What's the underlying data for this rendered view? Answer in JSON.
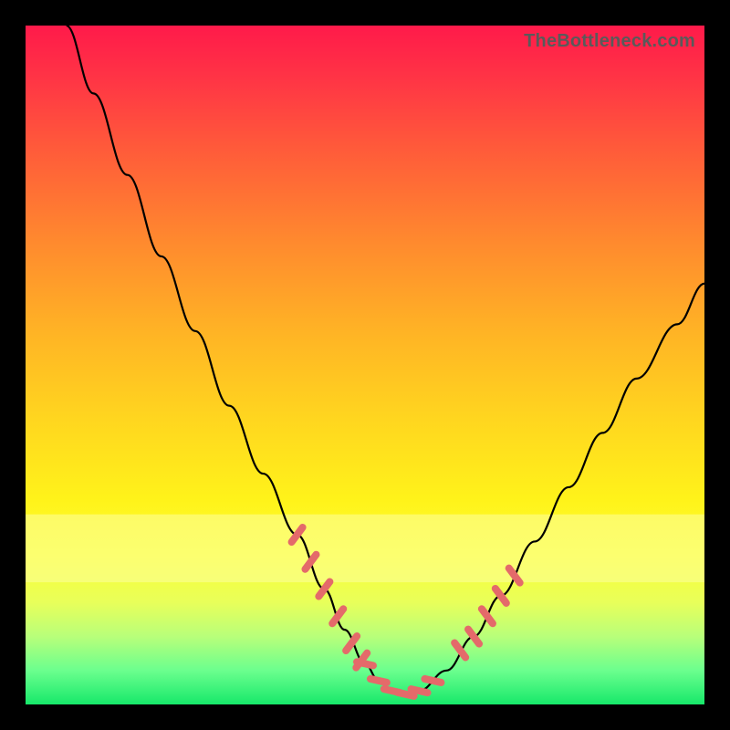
{
  "watermark": "TheBottleneck.com",
  "chart_data": {
    "type": "line",
    "title": "",
    "xlabel": "",
    "ylabel": "",
    "xlim": [
      0,
      100
    ],
    "ylim": [
      0,
      100
    ],
    "series": [
      {
        "name": "curve",
        "x": [
          6,
          10,
          15,
          20,
          25,
          30,
          35,
          40,
          44,
          47,
          50,
          52,
          54,
          56,
          58,
          62,
          66,
          70,
          75,
          80,
          85,
          90,
          96,
          100
        ],
        "y": [
          100,
          90,
          78,
          66,
          55,
          44,
          34,
          25,
          17,
          11,
          6,
          3.5,
          2,
          1.5,
          2,
          5,
          10,
          16,
          24,
          32,
          40,
          48,
          56,
          62
        ]
      }
    ],
    "highlight_segments": {
      "left": {
        "x": [
          40,
          42,
          44,
          46,
          48,
          49.5
        ],
        "y": [
          25,
          21,
          17,
          13,
          9,
          6.5
        ]
      },
      "bottom": {
        "x": [
          50,
          52,
          54,
          56,
          58,
          60
        ],
        "y": [
          6,
          3.5,
          2,
          1.5,
          2,
          3.5
        ]
      },
      "right": {
        "x": [
          64,
          66,
          68,
          70,
          72
        ],
        "y": [
          8,
          10,
          13,
          16,
          19
        ]
      }
    },
    "pale_band_y": [
      18,
      28
    ]
  }
}
